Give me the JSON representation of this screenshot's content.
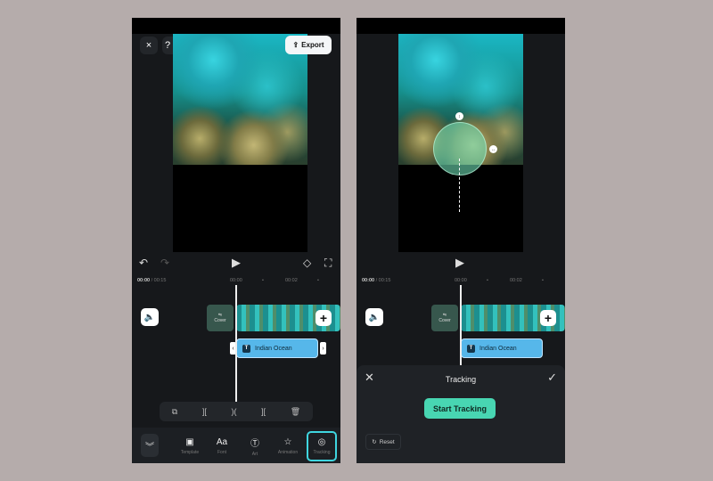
{
  "left": {
    "export_label": "Export",
    "close_icon": "×",
    "help_icon": "?",
    "time_current": "00:00",
    "time_total": "/ 00:15",
    "ruler": [
      "00:00",
      "•",
      "00:02",
      "•"
    ],
    "cover_label": "Cover",
    "text_clip": "Indian Ocean",
    "nav": [
      {
        "label": "Template",
        "icon": "template-icon",
        "glyph": "▣"
      },
      {
        "label": "Font",
        "icon": "font-icon",
        "glyph": "Aa"
      },
      {
        "label": "Art",
        "icon": "art-icon",
        "glyph": "Ⓣ"
      },
      {
        "label": "Animation",
        "icon": "animation-icon",
        "glyph": "☆"
      },
      {
        "label": "Tracking",
        "icon": "tracking-icon",
        "glyph": "◎"
      }
    ],
    "active_nav": "Tracking",
    "accent": "#3fd6e0"
  },
  "right": {
    "time_current": "00:00",
    "time_total": "/ 00:15",
    "ruler": [
      "00:00",
      "•",
      "00:02",
      "•"
    ],
    "cover_label": "Cover",
    "text_clip": "Indian Ocean",
    "panel_title": "Tracking",
    "start_label": "Start Tracking",
    "reset_label": "Reset",
    "start_color": "#48d6b2"
  }
}
